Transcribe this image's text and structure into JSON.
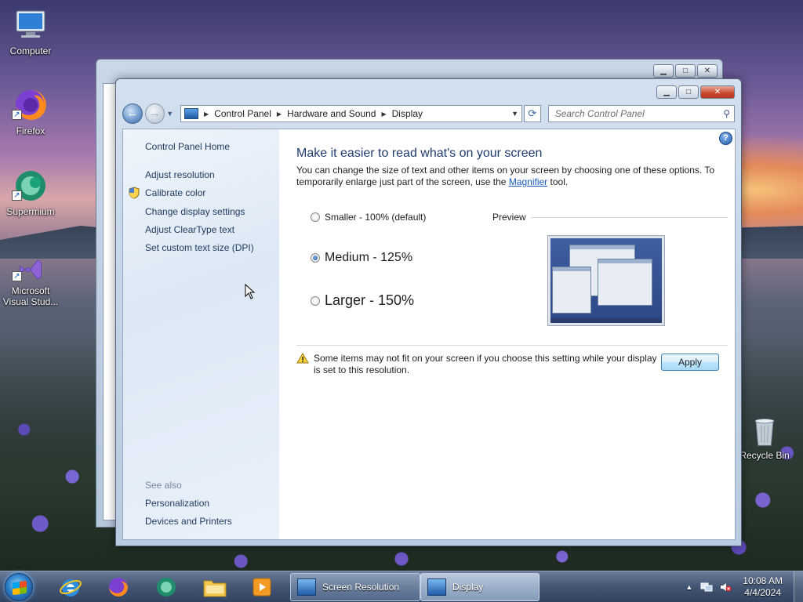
{
  "desktop": {
    "icons": [
      {
        "label": "Computer"
      },
      {
        "label": "Firefox"
      },
      {
        "label": "Supermium"
      },
      {
        "label": "Microsoft Visual Stud..."
      },
      {
        "label": "Recycle Bin"
      }
    ]
  },
  "window": {
    "breadcrumb": [
      "Control Panel",
      "Hardware and Sound",
      "Display"
    ],
    "search_placeholder": "Search Control Panel",
    "left_pane": {
      "home": "Control Panel Home",
      "links": [
        "Adjust resolution",
        "Calibrate color",
        "Change display settings",
        "Adjust ClearType text",
        "Set custom text size (DPI)"
      ],
      "see_also_label": "See also",
      "see_also_links": [
        "Personalization",
        "Devices and Printers"
      ]
    },
    "main": {
      "title": "Make it easier to read what's on your screen",
      "description_before": "You can change the size of text and other items on your screen by choosing one of these options. To temporarily enlarge just part of the screen, use the ",
      "description_link": "Magnifier",
      "description_after": " tool.",
      "options": [
        {
          "label": "Smaller - 100% (default)",
          "selected": false
        },
        {
          "label": "Medium - 125%",
          "selected": true
        },
        {
          "label": "Larger - 150%",
          "selected": false
        }
      ],
      "preview_label": "Preview",
      "warning": "Some items may not fit on your screen if you choose this setting while your display is set to this resolution.",
      "apply_label": "Apply"
    }
  },
  "taskbar": {
    "buttons": [
      {
        "label": "Screen Resolution"
      },
      {
        "label": "Display"
      }
    ],
    "time": "10:08 AM",
    "date": "4/4/2024"
  }
}
